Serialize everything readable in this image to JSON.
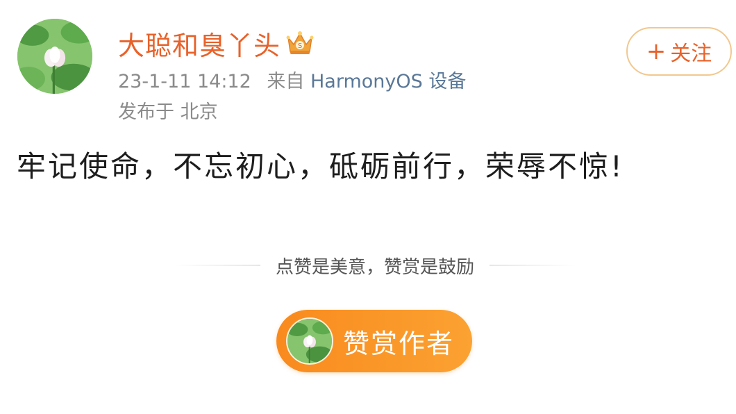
{
  "author": {
    "name": "大聪和臭丫头",
    "avatar_icon": "lotus-avatar-icon",
    "badge_icon": "crown-badge-icon"
  },
  "meta": {
    "time": "23-1-11 14:12",
    "source_prefix": "来自",
    "source": "HarmonyOS 设备",
    "location": "发布于 北京"
  },
  "follow_button": {
    "plus": "+",
    "label": "关注"
  },
  "post": {
    "text": "牢记使命，不忘初心，砥砺前行，荣辱不惊!"
  },
  "reward": {
    "hint": "点赞是美意，赞赏是鼓励",
    "button_label": "赞赏作者"
  },
  "colors": {
    "username": "#e8622a",
    "source_link": "#5a7898",
    "reward_button": "#f98a1e"
  }
}
